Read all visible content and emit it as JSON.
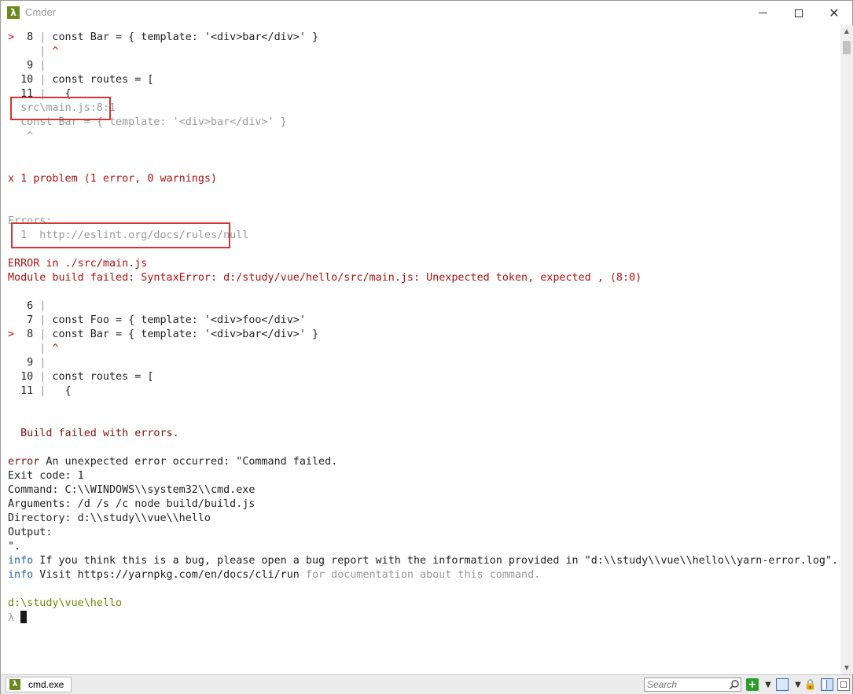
{
  "window": {
    "title": "Cmder",
    "app_icon_glyph": "λ",
    "min_label": "minimize",
    "max_label": "maximize",
    "close_glyph": "✕"
  },
  "console": {
    "lines": [
      {
        "segments": [
          {
            "t": ">",
            "c": "marker"
          },
          {
            "t": "  8 "
          },
          {
            "t": "|",
            "c": "gutter-bar"
          },
          {
            "t": " const Bar = { template: '<div>bar</div>' }"
          }
        ]
      },
      {
        "segments": [
          {
            "t": "     "
          },
          {
            "t": "|",
            "c": "gutter-bar"
          },
          {
            "t": " ^",
            "c": "red"
          }
        ]
      },
      {
        "segments": [
          {
            "t": "   9 "
          },
          {
            "t": "|",
            "c": "gutter-bar"
          }
        ]
      },
      {
        "segments": [
          {
            "t": "  10 "
          },
          {
            "t": "|",
            "c": "gutter-bar"
          },
          {
            "t": " const routes = ["
          }
        ]
      },
      {
        "segments": [
          {
            "t": "  11 "
          },
          {
            "t": "|",
            "c": "gutter-bar"
          },
          {
            "t": "   {"
          }
        ]
      },
      {
        "segments": [
          {
            "t": "  src\\main.js:8:1",
            "c": "dim"
          }
        ]
      },
      {
        "segments": [
          {
            "t": "  const Bar = { template: '<div>bar</div>' }",
            "c": "dim"
          }
        ]
      },
      {
        "segments": [
          {
            "t": "   ^",
            "c": "dim"
          }
        ]
      },
      {
        "segments": []
      },
      {
        "segments": []
      },
      {
        "segments": [
          {
            "t": "x",
            "c": "red"
          },
          {
            "t": " 1 problem (1 error, 0 warnings)",
            "c": "red"
          }
        ]
      },
      {
        "segments": []
      },
      {
        "segments": []
      },
      {
        "segments": [
          {
            "t": "Errors:",
            "c": "dim"
          }
        ]
      },
      {
        "segments": [
          {
            "t": "  1  http://eslint.org/docs/rules/",
            "c": "dim"
          },
          {
            "t": "null",
            "c": "dim"
          }
        ]
      },
      {
        "segments": []
      },
      {
        "segments": [
          {
            "t": "ERROR in ./src/main.js",
            "c": "red"
          }
        ]
      },
      {
        "segments": [
          {
            "t": "Module build failed: SyntaxError: d:/study/vue/hello/src/main.js: Unexpected token, expected , (8:0)",
            "c": "red"
          }
        ]
      },
      {
        "segments": []
      },
      {
        "segments": [
          {
            "t": "   6 "
          },
          {
            "t": "|",
            "c": "gutter-bar"
          }
        ]
      },
      {
        "segments": [
          {
            "t": "   7 "
          },
          {
            "t": "|",
            "c": "gutter-bar"
          },
          {
            "t": " const Foo = { template: '<div>foo</div>'"
          }
        ]
      },
      {
        "segments": [
          {
            "t": ">",
            "c": "marker"
          },
          {
            "t": "  8 "
          },
          {
            "t": "|",
            "c": "gutter-bar"
          },
          {
            "t": " const Bar = { template: '<div>bar</div>' }"
          }
        ]
      },
      {
        "segments": [
          {
            "t": "     "
          },
          {
            "t": "|",
            "c": "gutter-bar"
          },
          {
            "t": " ^",
            "c": "red"
          }
        ]
      },
      {
        "segments": [
          {
            "t": "   9 "
          },
          {
            "t": "|",
            "c": "gutter-bar"
          }
        ]
      },
      {
        "segments": [
          {
            "t": "  10 "
          },
          {
            "t": "|",
            "c": "gutter-bar"
          },
          {
            "t": " const routes = ["
          }
        ]
      },
      {
        "segments": [
          {
            "t": "  11 "
          },
          {
            "t": "|",
            "c": "gutter-bar"
          },
          {
            "t": "   {"
          }
        ]
      },
      {
        "segments": []
      },
      {
        "segments": []
      },
      {
        "segments": [
          {
            "t": "  Build failed with errors.",
            "c": "darkred"
          }
        ]
      },
      {
        "segments": []
      },
      {
        "segments": [
          {
            "t": "error",
            "c": "darkred"
          },
          {
            "t": " An unexpected error occurred: \"Command failed."
          }
        ]
      },
      {
        "segments": [
          {
            "t": "Exit code: 1"
          }
        ]
      },
      {
        "segments": [
          {
            "t": "Command: C:\\\\WINDOWS\\\\system32\\\\cmd.exe"
          }
        ]
      },
      {
        "segments": [
          {
            "t": "Arguments: /d /s /c node build/build.js"
          }
        ]
      },
      {
        "segments": [
          {
            "t": "Directory: d:\\\\study\\\\vue\\\\hello"
          }
        ]
      },
      {
        "segments": [
          {
            "t": "Output:"
          }
        ]
      },
      {
        "segments": [
          {
            "t": "\"."
          }
        ]
      },
      {
        "segments": [
          {
            "t": "info",
            "c": "blue"
          },
          {
            "t": " If you think this is a bug, please open a bug report with the information provided in \"d:\\\\study\\\\vue\\\\hello\\\\yarn-error.log\"."
          }
        ]
      },
      {
        "segments": [
          {
            "t": "info",
            "c": "blue"
          },
          {
            "t": " Visit https://yarnpkg.com/en/docs/cli/run "
          },
          {
            "t": "for documentation about this command.",
            "c": "dim"
          }
        ]
      },
      {
        "segments": []
      },
      {
        "segments": [
          {
            "t": "d:\\study\\vue\\hello",
            "c": "olive"
          }
        ]
      },
      {
        "segments": [
          {
            "t": "λ ",
            "c": "dim"
          },
          {
            "cursor": true
          }
        ]
      }
    ]
  },
  "tabbar": {
    "tab_label": "cmd.exe",
    "tab_icon_glyph": "λ",
    "search_placeholder": "Search",
    "add_glyph": "+",
    "dropdown_glyph": "▼",
    "lock_glyph": "🔒"
  },
  "scrollbar": {
    "up_glyph": "▲",
    "down_glyph": "▼"
  }
}
